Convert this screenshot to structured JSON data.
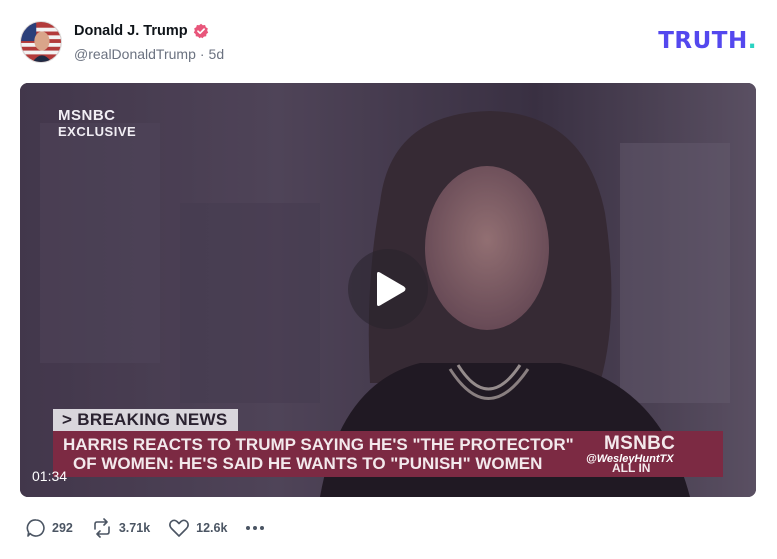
{
  "post": {
    "author": {
      "display_name": "Donald J. Trump",
      "handle": "@realDonaldTrump",
      "separator": "·",
      "time_ago": "5d",
      "verified_icon": "verified-badge-icon"
    },
    "brand_logo": {
      "main": "TRUTH",
      "dot": "."
    },
    "video": {
      "duration": "01:34",
      "play_icon": "play-icon",
      "overlay": {
        "network_top_line1": "MSNBC",
        "network_top_line2": "EXCLUSIVE",
        "breaking_label": "> BREAKING NEWS",
        "headline_line1": "HARRIS REACTS TO TRUMP SAYING HE'S \"THE PROTECTOR\"",
        "headline_line2": "OF WOMEN: HE'S SAID HE WANTS TO \"PUNISH\" WOMEN",
        "network_bottom": "MSNBC",
        "show_tag": "ALL IN",
        "watermark": "@WesleyHuntTX"
      }
    },
    "actions": {
      "replies": "292",
      "reposts": "3.71k",
      "likes": "12.6k",
      "more_icon": "more-horizontal-icon"
    }
  },
  "colors": {
    "brand_purple": "#5448ee",
    "brand_teal": "#2ad3c2",
    "verified_pink": "#e8557a",
    "headline_bar": "#7c2a43"
  }
}
